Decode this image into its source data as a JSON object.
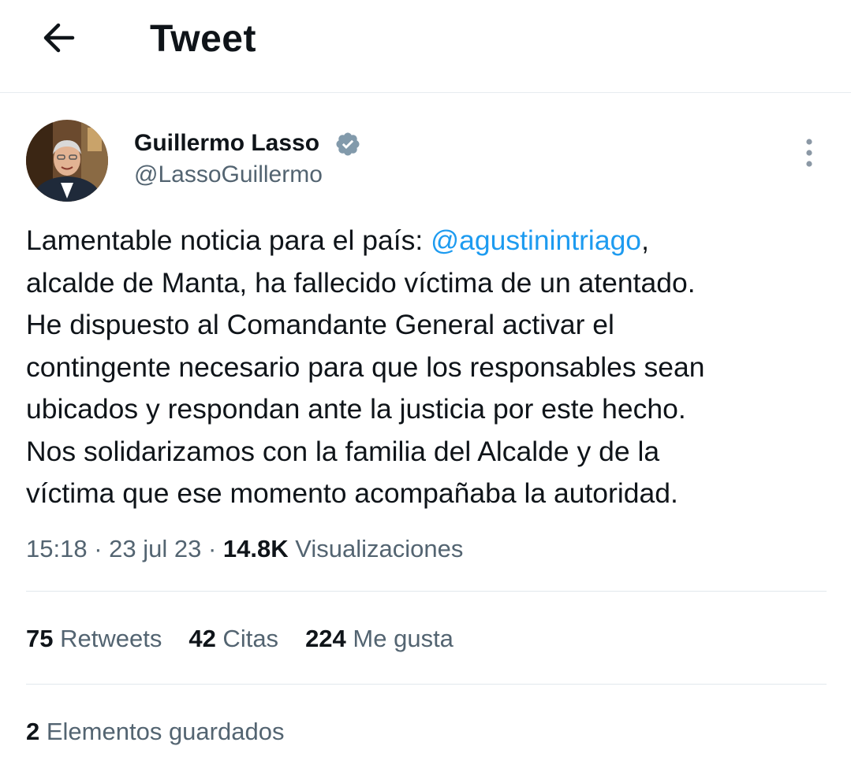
{
  "header": {
    "title": "Tweet",
    "back_icon": "arrow-left-icon"
  },
  "author": {
    "display_name": "Guillermo Lasso",
    "handle": "@LassoGuillermo",
    "verified_icon": "verified-badge-icon",
    "verified_color": "#829aab"
  },
  "tweet": {
    "line1_before": "Lamentable noticia para el país: ",
    "mention": "@agustinintriago",
    "line1_after": ",",
    "line2": "alcalde de Manta, ha fallecido víctima de un atentado.",
    "line3": "He dispuesto al Comandante General activar el",
    "line4": "contingente necesario para que los responsables sean",
    "line5": "ubicados y respondan ante la justicia por este hecho.",
    "line6": "Nos solidarizamos con la familia del Alcalde y de la",
    "line7": "víctima que ese momento acompañaba la autoridad."
  },
  "meta": {
    "time": "15:18",
    "separator1": " · ",
    "date": "23 jul 23",
    "separator2": " · ",
    "views_count": "14.8K",
    "views_label": " Visualizaciones"
  },
  "stats": {
    "retweets_count": "75",
    "retweets_label": " Retweets",
    "quotes_count": "42",
    "quotes_label": " Citas",
    "likes_count": "224",
    "likes_label": " Me gusta"
  },
  "bookmarks": {
    "count": "2",
    "label": " Elementos guardados"
  },
  "colors": {
    "accent": "#1d9bf0",
    "text_primary": "#0f1419",
    "text_secondary": "#536471",
    "divider": "#e1e8ed"
  }
}
